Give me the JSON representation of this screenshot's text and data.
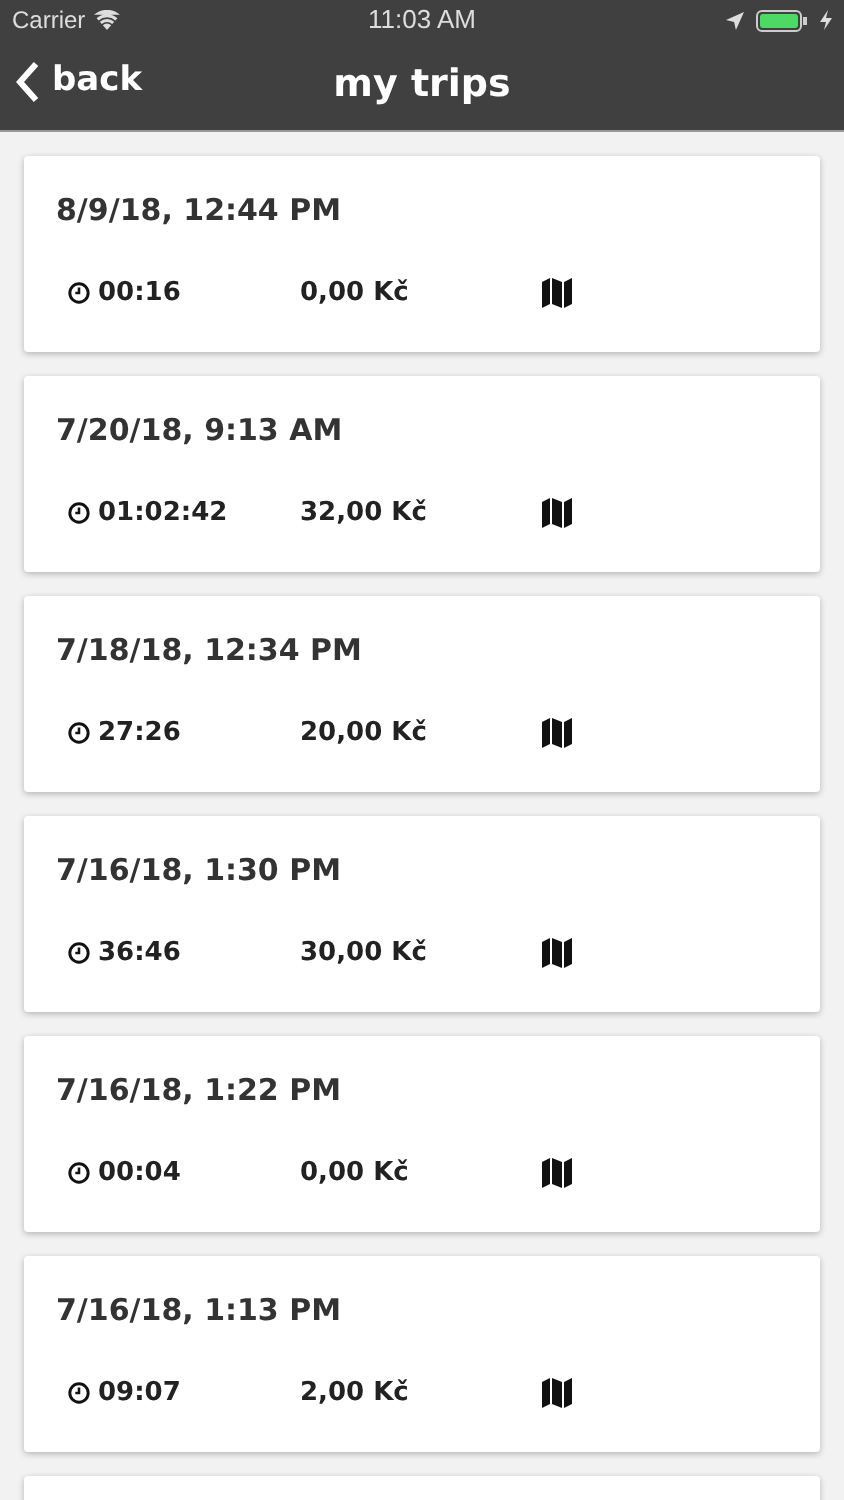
{
  "status_bar": {
    "carrier": "Carrier",
    "time": "11:03 AM"
  },
  "nav": {
    "back": "back",
    "title": "my trips"
  },
  "trips": [
    {
      "date": "8/9/18, 12:44 PM",
      "duration": "00:16",
      "price": "0,00 Kč"
    },
    {
      "date": "7/20/18, 9:13 AM",
      "duration": "01:02:42",
      "price": "32,00 Kč"
    },
    {
      "date": "7/18/18, 12:34 PM",
      "duration": "27:26",
      "price": "20,00 Kč"
    },
    {
      "date": "7/16/18, 1:30 PM",
      "duration": "36:46",
      "price": "30,00 Kč"
    },
    {
      "date": "7/16/18, 1:22 PM",
      "duration": "00:04",
      "price": "0,00 Kč"
    },
    {
      "date": "7/16/18, 1:13 PM",
      "duration": "09:07",
      "price": "2,00 Kč"
    }
  ]
}
